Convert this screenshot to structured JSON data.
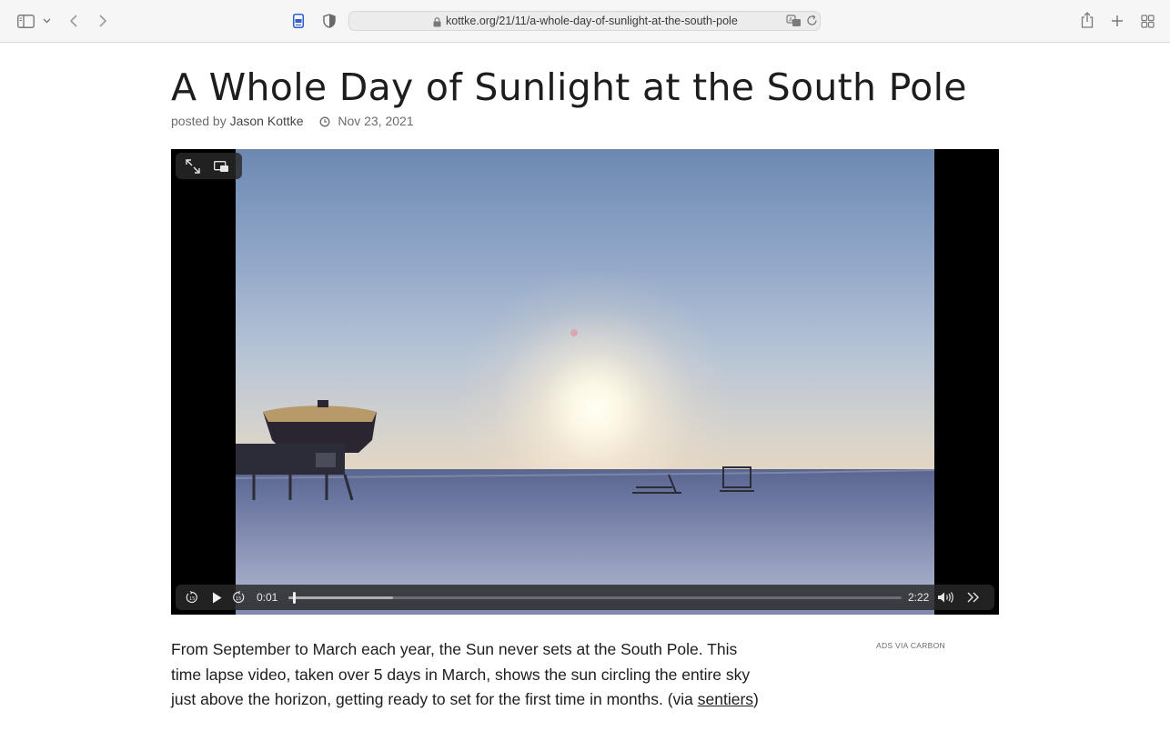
{
  "browser": {
    "url": "kottke.org/21/11/a-whole-day-of-sunlight-at-the-south-pole",
    "icons": [
      "sidebar-icon",
      "chevron-down-icon",
      "back-icon",
      "forward-icon",
      "reader-icon",
      "shield-icon",
      "lock-icon",
      "translate-icon",
      "reload-icon",
      "share-icon",
      "new-tab-icon",
      "tab-overview-icon"
    ]
  },
  "article": {
    "title": "A Whole Day of Sunlight at the South Pole",
    "posted_by_label": "posted by",
    "author": "Jason Kottke",
    "date": "Nov 23, 2021",
    "body_text": "From September to March each year, the Sun never sets at the South Pole. This time lapse video, taken over 5 days in March, shows the sun circling the entire sky just above the horizon, getting ready to set for the first time in months. (via ",
    "via_link": "sentiers",
    "body_end": ")"
  },
  "video": {
    "current_time": "0:01",
    "duration": "2:22",
    "progress_fraction": 0.007,
    "buffered_fraction": 0.17
  },
  "sidebar": {
    "ads_label": "ADS VIA CARBON"
  }
}
